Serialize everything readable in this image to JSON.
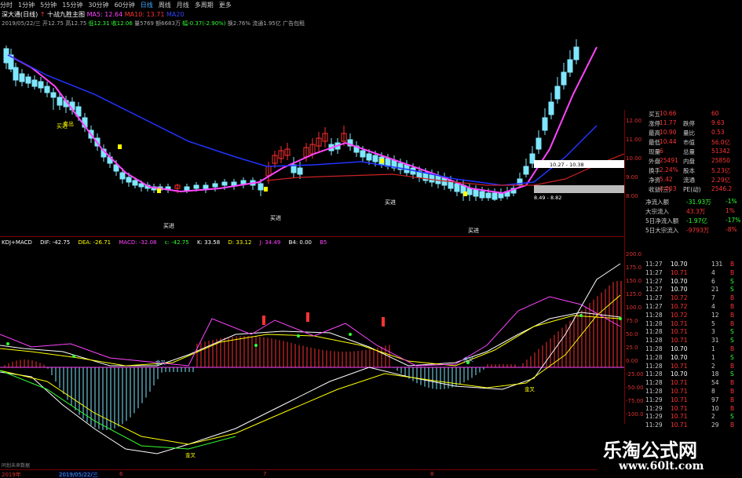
{
  "toolbar": {
    "items": [
      "分时",
      "1分钟",
      "5分钟",
      "15分钟",
      "30分钟",
      "60分钟",
      "日线",
      "周线",
      "月线",
      "多周期",
      "更多"
    ],
    "active_index": 6
  },
  "title": {
    "stock": "深大通(日线)",
    "indicator": "十战九胜主图",
    "ma5": "MA5: 12.64",
    "ma10": "MA10: 13.71",
    "ma20": "MA20"
  },
  "info": {
    "date": "2019/05/22/三",
    "open": "开12.75",
    "high": "高12.75",
    "low": "低12.31",
    "close": "收12.06",
    "vol": "量5769",
    "amount": "额6683万",
    "change": "幅-0.37(-2.90%)",
    "turnover": "换2.76%",
    "float": "流通1.95亿",
    "ad": "广告包租"
  },
  "signals": {
    "buy1": "买进",
    "buy2": "买进",
    "buy3": "买进",
    "buy4": "买进",
    "buy5": "买进",
    "sell": "卖出",
    "box_high": "10.27 - 10.38",
    "box_low": "8.49 - 8.82"
  },
  "indicator_header": {
    "name": "KDJ+MACD",
    "dif": "DIF: -42.75",
    "dea": "DEA: -26.71",
    "macd": "MACD: -32.08",
    "c": "c: -42.75",
    "k": "K: 33.58",
    "d": "D: 33.12",
    "j": "J: 34.49",
    "b4": "B4: 0.00",
    "b5": "B5"
  },
  "cross_labels": {
    "a": "金叉",
    "b": "金叉",
    "c": "金叉",
    "d": "金叉"
  },
  "price_axis": [
    "12.00",
    "11.00",
    "10.00",
    "9.00",
    "8.00"
  ],
  "ind_axis": [
    "200.0",
    "175.0",
    "150.0",
    "125.0",
    "100.0",
    "75.0",
    "50.0",
    "25.0",
    "0.00",
    "-25.00",
    "-50.00",
    "-75.00",
    "-100.0"
  ],
  "quote": [
    {
      "l1": "买五",
      "v1": "10.66",
      "l2": "",
      "v2": "60"
    },
    {
      "l1": "涨停",
      "v1": "11.77",
      "l2": "跌停",
      "v2": "9.63"
    },
    {
      "l1": "最高",
      "v1": "10.90",
      "l2": "量比",
      "v2": "0.53"
    },
    {
      "l1": "最低",
      "v1": "10.44",
      "l2": "市值",
      "v2": "56.0亿"
    },
    {
      "l1": "现量",
      "v1": "6",
      "l2": "总量",
      "v2": "51342"
    },
    {
      "l1": "外盘",
      "v1": "25491",
      "l2": "内盘",
      "v2": "25850"
    },
    {
      "l1": "换手",
      "v1": "2.24%",
      "l2": "股本",
      "v2": "5.23亿"
    },
    {
      "l1": "净资",
      "v1": "5.42",
      "l2": "流通",
      "v2": "2.29亿"
    },
    {
      "l1": "收益(三)",
      "v1": "0.003",
      "l2": "PE(动)",
      "v2": "2546.2"
    }
  ],
  "flow": [
    {
      "label": "净流入额",
      "v1": "-31.93万",
      "v2": "-1%"
    },
    {
      "label": "大宗流入",
      "v1": "43.3万",
      "v2": "1%"
    },
    {
      "label": "5日净流入额",
      "v1": "-1.97亿",
      "v2": "-17%"
    },
    {
      "label": "5日大宗流入",
      "v1": "-9793万",
      "v2": "-8%"
    }
  ],
  "ticks": [
    {
      "t": "11:27",
      "p": "10.70",
      "v": "131",
      "s": "B"
    },
    {
      "t": "11:27",
      "p": "10.71",
      "v": "4",
      "s": "B"
    },
    {
      "t": "11:27",
      "p": "10.70",
      "v": "6",
      "s": "S"
    },
    {
      "t": "11:27",
      "p": "10.70",
      "v": "21",
      "s": "S"
    },
    {
      "t": "11:27",
      "p": "10.72",
      "v": "7",
      "s": "B"
    },
    {
      "t": "11:27",
      "p": "10.72",
      "v": "4",
      "s": "B"
    },
    {
      "t": "11:28",
      "p": "10.72",
      "v": "12",
      "s": "B"
    },
    {
      "t": "11:28",
      "p": "10.71",
      "v": "5",
      "s": "B"
    },
    {
      "t": "11:28",
      "p": "10.71",
      "v": "3",
      "s": "S"
    },
    {
      "t": "11:28",
      "p": "10.71",
      "v": "31",
      "s": "S"
    },
    {
      "t": "11:28",
      "p": "10.70",
      "v": "1",
      "s": "B"
    },
    {
      "t": "11:28",
      "p": "10.70",
      "v": "1",
      "s": "S"
    },
    {
      "t": "11:28",
      "p": "10.71",
      "v": "2",
      "s": "B"
    },
    {
      "t": "11:28",
      "p": "10.70",
      "v": "18",
      "s": "S"
    },
    {
      "t": "11:28",
      "p": "10.71",
      "v": "54",
      "b": "",
      "s": "B"
    },
    {
      "t": "11:28",
      "p": "10.71",
      "v": "8",
      "s": "B"
    },
    {
      "t": "11:29",
      "p": "10.71",
      "v": "97",
      "s": "B"
    },
    {
      "t": "11:29",
      "p": "10.71",
      "v": "10",
      "s": "B"
    },
    {
      "t": "11:29",
      "p": "10.71",
      "v": "2",
      "s": "S"
    },
    {
      "t": "11:29",
      "p": "10.71",
      "v": "29",
      "s": "B"
    }
  ],
  "bottom_axis": {
    "year": "2019年",
    "date": "2019/05/22/三",
    "m6": "6",
    "m7": "7",
    "m8": "8"
  },
  "bottom_note": "同划未来数据",
  "watermark": {
    "cn": "乐淘公式网",
    "url": "www.60lt.com"
  },
  "colors": {
    "up": "#ff3030",
    "down": "#7fe7ff",
    "ma_short": "#ff44ff",
    "ma_long": "#2233ff",
    "ma_mid": "#cc2222",
    "macd_up": "#ff3030",
    "macd_down": "#7fe7ff"
  }
}
